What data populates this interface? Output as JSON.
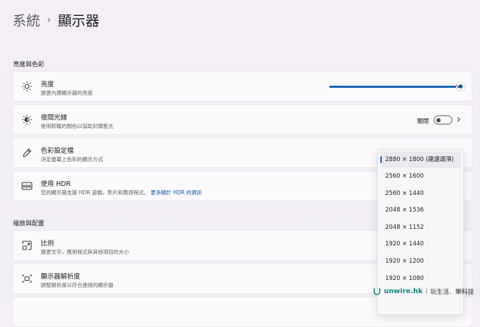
{
  "breadcrumb": {
    "parent": "系統",
    "separator": "›",
    "current": "顯示器"
  },
  "sections": {
    "brightness_color": "亮度與色彩",
    "scale_layout": "縮放與配置"
  },
  "brightness": {
    "title": "亮度",
    "desc": "變更內建顯示器的亮度",
    "level_percent": 100,
    "icon": "sun-icon"
  },
  "night_light": {
    "title": "夜間光線",
    "desc": "使用較暖的顏色以協助封鎖藍光",
    "toggle_label": "關閉",
    "icon": "night-sun-icon"
  },
  "color_profile": {
    "title": "色彩設定檔",
    "desc": "決定螢幕上色彩的顯示方式",
    "icon": "eyedropper-icon"
  },
  "hdr": {
    "title": "使用 HDR",
    "desc": "您的顯示器支援 HDR 遊戲，影片和應用程式。",
    "link": "更多關於 HDR 的資訊",
    "icon": "hdr-icon"
  },
  "scale": {
    "title": "比例",
    "desc": "變更文字，應用程式與其他項目的大小",
    "icon": "scale-icon"
  },
  "resolution": {
    "title": "顯示器解析度",
    "desc": "調整解析度以符合連接的顯示器",
    "icon": "resolution-icon",
    "options": [
      "2880 × 1800 (建議選項)",
      "2560 × 1600",
      "2560 × 1440",
      "2048 × 1536",
      "2048 × 1152",
      "1920 × 1440",
      "1920 × 1200",
      "1920 × 1080"
    ],
    "selected_index": 0
  },
  "watermark": {
    "logo": "unwire.hk",
    "tagline": "玩生活．樂科技"
  },
  "colors": {
    "accent": "#1162b4"
  }
}
